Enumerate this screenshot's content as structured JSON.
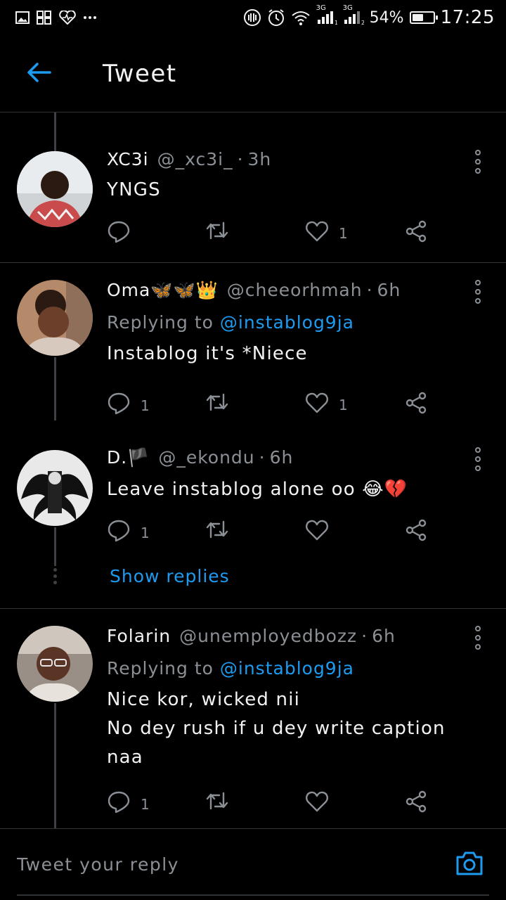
{
  "status_bar": {
    "left_icons": [
      "gallery-icon",
      "apps-icon",
      "health-icon",
      "more-dots-icon"
    ],
    "right_icons": [
      "vibrate-icon",
      "alarm-icon",
      "wifi-icon",
      "signal-1-icon",
      "signal-2-icon"
    ],
    "network_1": "3G",
    "network_2": "3G",
    "battery_percent": "54%",
    "battery_level": 0.54,
    "time": "17:25"
  },
  "header": {
    "title": "Tweet",
    "back_icon": "arrow-left-icon"
  },
  "colors": {
    "accent": "#1d9bf0",
    "background": "#000000",
    "muted": "#8b9096",
    "divider": "#2f3336"
  },
  "tweets": [
    {
      "name": "XC3i",
      "handle": "@_xc3i_",
      "dot": "·",
      "time": "3h",
      "replying_prefix": "",
      "replying_to": "",
      "text": "YNGS",
      "reply_count": "",
      "retweet_count": "",
      "like_count": "1"
    },
    {
      "name": "Oma🦋🦋👑",
      "handle": "@cheeorhmah",
      "dot": "·",
      "time": "6h",
      "replying_prefix": "Replying to ",
      "replying_to": "@instablog9ja",
      "text": "Instablog it's *Niece",
      "reply_count": "1",
      "retweet_count": "",
      "like_count": "1"
    },
    {
      "name": "D.🏴",
      "handle": "@_ekondu",
      "dot": "·",
      "time": "6h",
      "replying_prefix": "",
      "replying_to": "",
      "text": "Leave instablog alone oo 😂💔",
      "reply_count": "1",
      "retweet_count": "",
      "like_count": ""
    },
    {
      "name": "Folarin",
      "handle": "@unemployedbozz",
      "dot": "·",
      "time": "6h",
      "replying_prefix": "Replying to ",
      "replying_to": "@instablog9ja",
      "text": "Nice kor, wicked nii\nNo dey rush if u dey write caption naa",
      "reply_count": "1",
      "retweet_count": "",
      "like_count": ""
    }
  ],
  "show_replies": "Show replies",
  "reply_bar": {
    "placeholder": "Tweet your reply",
    "camera_icon": "camera-icon"
  }
}
